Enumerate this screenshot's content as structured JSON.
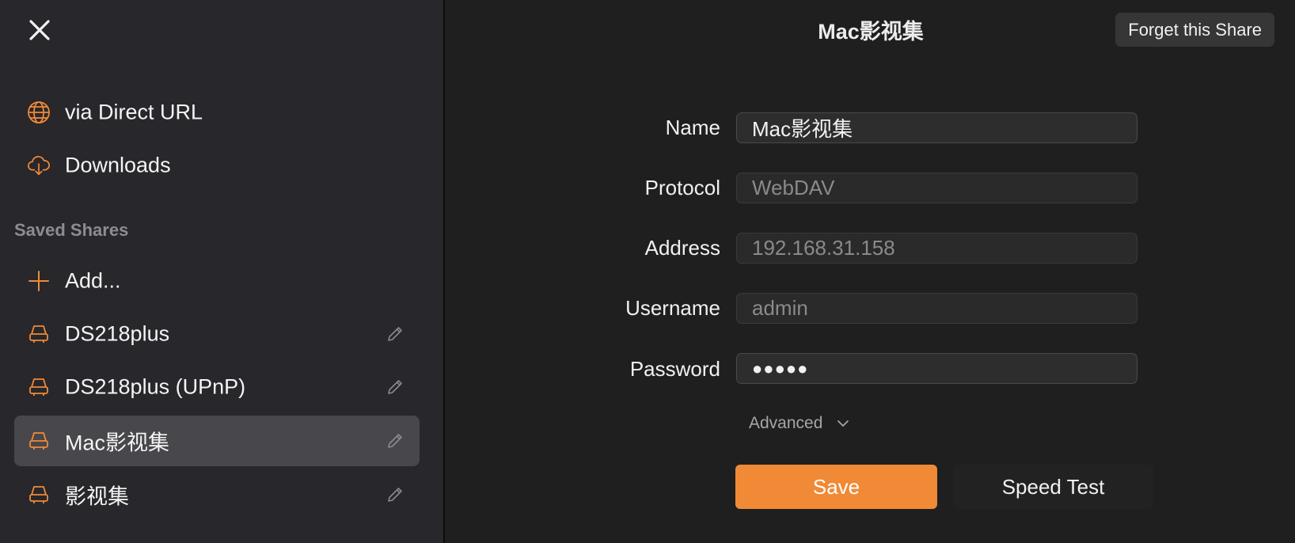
{
  "sidebar": {
    "nav_top": [
      {
        "label": "via Direct URL",
        "icon": "globe-icon"
      },
      {
        "label": "Downloads",
        "icon": "cloud-download-icon"
      }
    ],
    "section_title": "Saved Shares",
    "add_label": "Add...",
    "shares": [
      {
        "label": "DS218plus",
        "icon": "server-icon"
      },
      {
        "label": "DS218plus (UPnP)",
        "icon": "server-icon"
      },
      {
        "label": "Mac影视集",
        "icon": "server-icon",
        "selected": true
      },
      {
        "label": "影视集",
        "icon": "server-icon"
      }
    ]
  },
  "header": {
    "title": "Mac影视集",
    "forget_button": "Forget this Share"
  },
  "form": {
    "name_label": "Name",
    "name_value": "Mac影视集",
    "protocol_label": "Protocol",
    "protocol_value": "WebDAV",
    "address_label": "Address",
    "address_value": "192.168.31.158",
    "username_label": "Username",
    "username_value": "admin",
    "password_label": "Password",
    "password_value": "●●●●●",
    "advanced_label": "Advanced"
  },
  "actions": {
    "save_label": "Save",
    "speed_test_label": "Speed Test"
  },
  "colors": {
    "accent": "#f08a36",
    "sidebar_bg": "#28272b",
    "main_bg": "#1f1f1f",
    "selected_bg": "#48474c"
  }
}
